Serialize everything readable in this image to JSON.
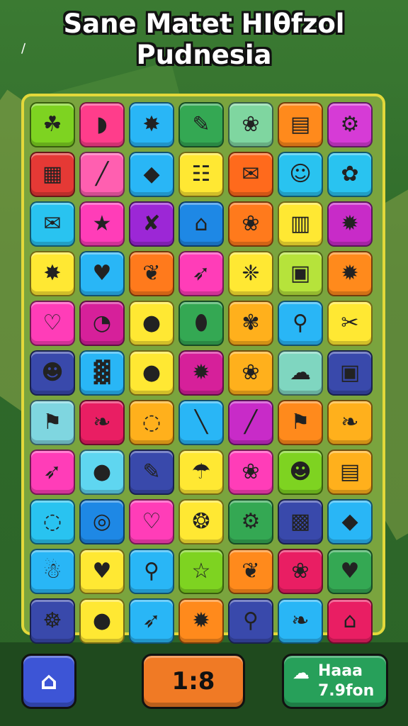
{
  "title": {
    "line1": "Sane Matet HIθfzol",
    "line2": "Pudnesia"
  },
  "corner_mark": "∕",
  "board": {
    "tiles": [
      {
        "icon": "☘",
        "color": "#7ed321"
      },
      {
        "icon": "◗",
        "color": "#ff3d8b"
      },
      {
        "icon": "✸",
        "color": "#29b6f6"
      },
      {
        "icon": "✎",
        "color": "#34a853"
      },
      {
        "icon": "❀",
        "color": "#7fd6a0"
      },
      {
        "icon": "▤",
        "color": "#ff8a1c"
      },
      {
        "icon": "⚙",
        "color": "#d63bd6"
      },
      {
        "icon": "▦",
        "color": "#e53935"
      },
      {
        "icon": "╱",
        "color": "#ff5fb0"
      },
      {
        "icon": "◆",
        "color": "#29b6f6"
      },
      {
        "icon": "☷",
        "color": "#ffe833"
      },
      {
        "icon": "✉",
        "color": "#ff6a1c"
      },
      {
        "icon": "☺",
        "color": "#29c3f0"
      },
      {
        "icon": "✿",
        "color": "#29c3f0"
      },
      {
        "icon": "✉",
        "color": "#29c3f0"
      },
      {
        "icon": "★",
        "color": "#ff3db8"
      },
      {
        "icon": "✘",
        "color": "#9c27d6"
      },
      {
        "icon": "⌂",
        "color": "#1e88e5"
      },
      {
        "icon": "❀",
        "color": "#ff7a1c"
      },
      {
        "icon": "▥",
        "color": "#ffe833"
      },
      {
        "icon": "✹",
        "color": "#c82bc8"
      },
      {
        "icon": "✸",
        "color": "#ffe833"
      },
      {
        "icon": "♥",
        "color": "#29b6f6"
      },
      {
        "icon": "❦",
        "color": "#ff7a1c"
      },
      {
        "icon": "➶",
        "color": "#ff3db8"
      },
      {
        "icon": "❈",
        "color": "#ffe833"
      },
      {
        "icon": "▣",
        "color": "#b6e33b"
      },
      {
        "icon": "✹",
        "color": "#ff8a1c"
      },
      {
        "icon": "♡",
        "color": "#ff3db8"
      },
      {
        "icon": "◔",
        "color": "#d6209a"
      },
      {
        "icon": "●",
        "color": "#ffe833"
      },
      {
        "icon": "⬮",
        "color": "#34a853"
      },
      {
        "icon": "✾",
        "color": "#ffb01c"
      },
      {
        "icon": "⚲",
        "color": "#29b6f6"
      },
      {
        "icon": "✂",
        "color": "#ffe833"
      },
      {
        "icon": "☻",
        "color": "#3949ab"
      },
      {
        "icon": "▓",
        "color": "#29b6f6"
      },
      {
        "icon": "●",
        "color": "#ffe833"
      },
      {
        "icon": "✹",
        "color": "#d6209a"
      },
      {
        "icon": "❀",
        "color": "#ffb01c"
      },
      {
        "icon": "☁",
        "color": "#7fd6c0"
      },
      {
        "icon": "▣",
        "color": "#3949ab"
      },
      {
        "icon": "⚑",
        "color": "#7fd6e0"
      },
      {
        "icon": "❧",
        "color": "#e91e63"
      },
      {
        "icon": "◌",
        "color": "#ffb01c"
      },
      {
        "icon": "╲",
        "color": "#29b6f6"
      },
      {
        "icon": "╱",
        "color": "#c82bc8"
      },
      {
        "icon": "⚑",
        "color": "#ff8a1c"
      },
      {
        "icon": "❧",
        "color": "#ffb01c"
      },
      {
        "icon": "➶",
        "color": "#ff3db8"
      },
      {
        "icon": "●",
        "color": "#5fd6f0"
      },
      {
        "icon": "✎",
        "color": "#3949ab"
      },
      {
        "icon": "☂",
        "color": "#ffe833"
      },
      {
        "icon": "❀",
        "color": "#ff3db8"
      },
      {
        "icon": "☻",
        "color": "#7ed321"
      },
      {
        "icon": "▤",
        "color": "#ffb01c"
      },
      {
        "icon": "◌",
        "color": "#29c3f0"
      },
      {
        "icon": "◎",
        "color": "#1e88e5"
      },
      {
        "icon": "♡",
        "color": "#ff3db8"
      },
      {
        "icon": "❂",
        "color": "#ffe833"
      },
      {
        "icon": "⚙",
        "color": "#34a853"
      },
      {
        "icon": "▩",
        "color": "#3949ab"
      },
      {
        "icon": "◆",
        "color": "#29b6f6"
      },
      {
        "icon": "☃",
        "color": "#29b6f6"
      },
      {
        "icon": "♥",
        "color": "#ffe833"
      },
      {
        "icon": "⚲",
        "color": "#29b6f6"
      },
      {
        "icon": "☆",
        "color": "#7ed321"
      },
      {
        "icon": "❦",
        "color": "#ff8a1c"
      },
      {
        "icon": "❀",
        "color": "#e91e63"
      },
      {
        "icon": "♥",
        "color": "#34a853"
      },
      {
        "icon": "☸",
        "color": "#3949ab"
      },
      {
        "icon": "●",
        "color": "#ffe833"
      },
      {
        "icon": "➶",
        "color": "#29b6f6"
      },
      {
        "icon": "✹",
        "color": "#ff8a1c"
      },
      {
        "icon": "⚲",
        "color": "#3949ab"
      },
      {
        "icon": "❧",
        "color": "#29b6f6"
      },
      {
        "icon": "⌂",
        "color": "#e91e63"
      }
    ]
  },
  "footer": {
    "home_icon": "⌂",
    "score": "1:8",
    "info_icon": "☁",
    "info_line1": "Haaa",
    "info_line2": "7.9fon"
  },
  "colors": {
    "board_border": "#e3d83a",
    "home": "#3d55d6",
    "score": "#f07a25",
    "info": "#27a05a"
  }
}
